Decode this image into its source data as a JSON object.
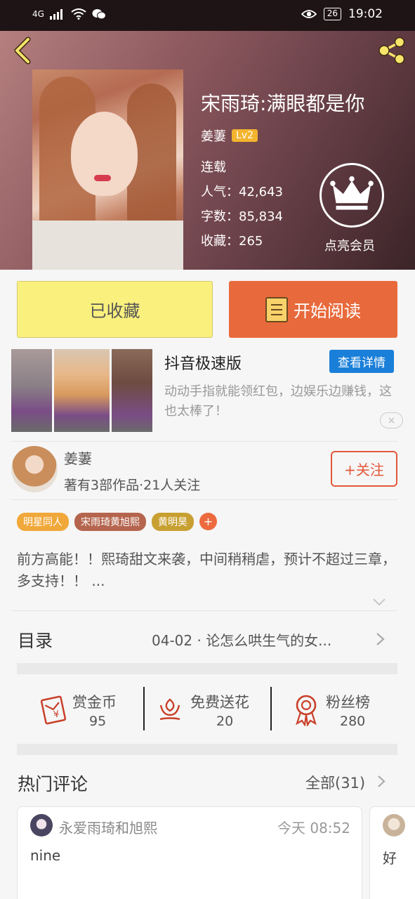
{
  "status_bar": {
    "network": "4G",
    "battery": "26",
    "time": "19:02"
  },
  "book": {
    "title": "宋雨琦:满眼都是你",
    "author": "姜萋",
    "author_level": "Lv2",
    "status": "连载",
    "popularity_label": "人气：",
    "popularity": "42,643",
    "words_label": "字数：",
    "words": "85,834",
    "favorites_label": "收藏：",
    "favorites": "265",
    "vip_label": "点亮会员"
  },
  "actions": {
    "collected_label": "已收藏",
    "read_label": "开始阅读"
  },
  "ad": {
    "title": "抖音极速版",
    "detail_button": "查看详情",
    "description": "动动手指就能领红包，边娱乐边赚钱，这也太棒了！",
    "close_icon": "×"
  },
  "author": {
    "name": "姜萋",
    "summary": "著有3部作品·21人关注",
    "follow_label": "+关注"
  },
  "tags": [
    {
      "label": "明星同人",
      "color": "#f0a83a"
    },
    {
      "label": "宋雨琦黄旭熙",
      "color": "#b5654e"
    },
    {
      "label": "黄明昊",
      "color": "#c8a032"
    }
  ],
  "tag_add": "+",
  "synopsis": "前方高能！！熙琦甜文来袭，中间稍稍虐，预计不超过三章，多支持！！ ...",
  "catalog": {
    "label": "目录",
    "latest": "04-02 · 论怎么哄生气的女..."
  },
  "stats": [
    {
      "label": "赏金币",
      "value": "95",
      "icon": "red-envelope-icon"
    },
    {
      "label": "免费送花",
      "value": "20",
      "icon": "flower-icon"
    },
    {
      "label": "粉丝榜",
      "value": "280",
      "icon": "medal-icon"
    }
  ],
  "comments_section": {
    "title": "热门评论",
    "all_label": "全部(31)",
    "items": [
      {
        "user": "永爱雨琦和旭熙",
        "time": "今天 08:52",
        "text": "nine"
      },
      {
        "user": "",
        "time": "",
        "text": "好"
      }
    ]
  },
  "colors": {
    "accent_orange": "#e86a3c",
    "collected_yellow": "#faf07e",
    "level_badge": "#f3b42e",
    "ad_blue": "#1a7fd9"
  }
}
